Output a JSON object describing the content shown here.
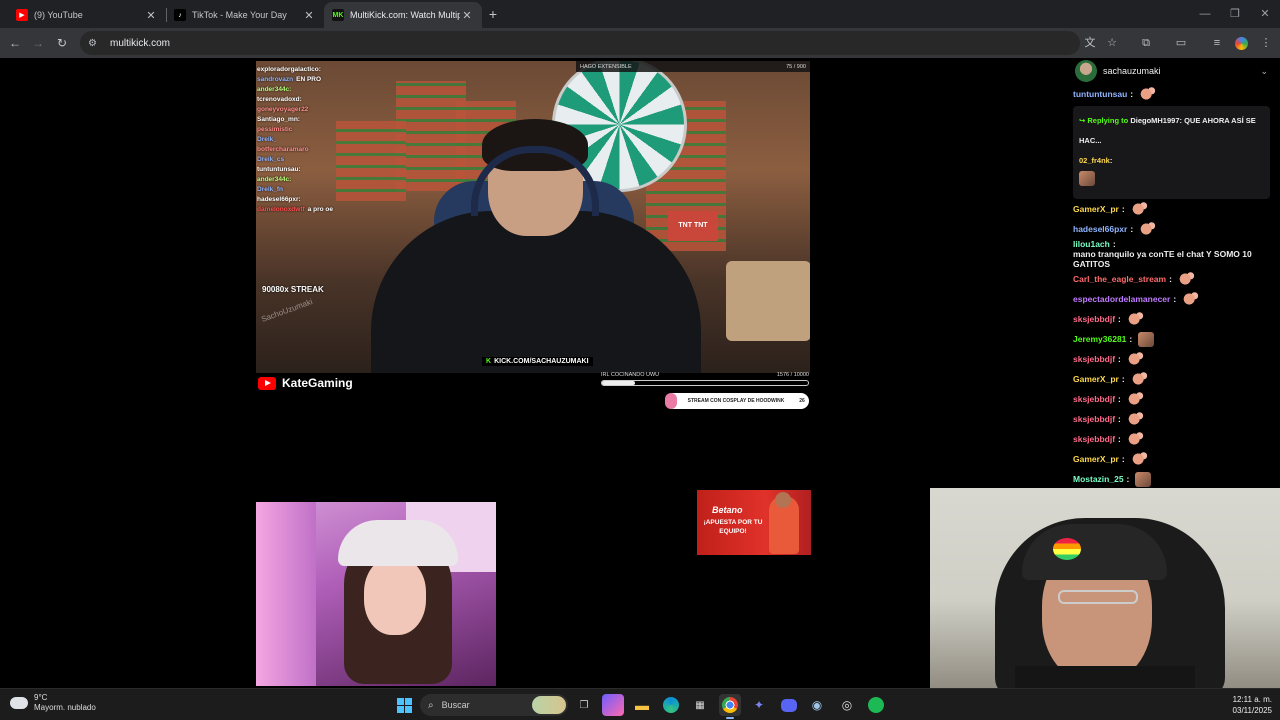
{
  "browser": {
    "tabs": [
      {
        "title": "(9) YouTube",
        "favicon": "youtube-icon",
        "active": false
      },
      {
        "title": "TikTok - Make Your Day",
        "favicon": "tiktok-icon",
        "active": false
      },
      {
        "title": "MultiKick.com: Watch Multiple",
        "favicon": "multikick-icon",
        "active": true
      }
    ],
    "url": "multikick.com"
  },
  "main_stream": {
    "overlay_chat": [
      {
        "user": "exploradorgalactico:",
        "color": "#ffffff"
      },
      {
        "user": "sandrovazn",
        "text": "EN PRO",
        "color": "#8fb4ff"
      },
      {
        "user": "ander344c:",
        "color": "#b5ff7a"
      },
      {
        "user": "tcrenovadoxd:",
        "color": "#ffffff"
      },
      {
        "user": "goneyvoyager22",
        "color": "#ff8a8a"
      },
      {
        "user": "Santiago_mn:",
        "color": "#ffffff"
      },
      {
        "user": "pessimistic",
        "color": "#ff8a8a"
      },
      {
        "user": "Dreik_",
        "color": "#8fb4ff"
      },
      {
        "user": "botfercharamaro",
        "color": "#ff8a8a"
      },
      {
        "user": "Dreik_cs",
        "color": "#8fb4ff"
      },
      {
        "user": "tuntuntunsau:",
        "color": "#ffffff"
      },
      {
        "user": "ander344c:",
        "color": "#b5ff7a"
      },
      {
        "user": "Dreik_fn",
        "color": "#8fb4ff"
      },
      {
        "user": "hadesel66pxr:",
        "color": "#ffffff"
      },
      {
        "user": "damelonoxdwtf",
        "text": "a pro oe",
        "color": "#ff4d4d"
      }
    ],
    "streak": "90080x STREAK",
    "kick_tag": "KICK.COM/SACHAUZUMAKI",
    "goal_top_label": "HAGO EXTENSIBLE",
    "goal_top_count": "75 / 900",
    "goal_bottom_label": "IRL COCINANDO UWU",
    "goal_bottom_count": "1576 / 10000",
    "goal_bottom_progress": 0.16,
    "goal_pill_text": "STREAM CON COSPLAY DE HOODWINK",
    "goal_pill_count": "26",
    "watermark": "SachoUzumaki",
    "tnt": "TNT TNT"
  },
  "second_stream": {
    "channel": "KateGaming"
  },
  "ad": {
    "brand": "Betano",
    "tagline": "¡APUESTA POR TU EQUIPO!"
  },
  "chat": {
    "channel": "sachauzumaki",
    "messages": [
      {
        "user": "tuntuntunsau",
        "color": "#8fb4ff",
        "text": "",
        "emote": true
      },
      {
        "reply": true,
        "reply_label": "Replying to",
        "reply_user": "DiegoMH1997",
        "reply_text": "QUE AHORA ASÍ SE HAC...",
        "user": "02_fr4nk",
        "color": "#ffd84d",
        "emote_pic": true
      },
      {
        "user": "GamerX_pr",
        "color": "#ffd84d",
        "text": "",
        "emote": true
      },
      {
        "user": "hadesel66pxr",
        "color": "#8fb4ff",
        "text": "",
        "emote": true
      },
      {
        "user": "lilou1ach",
        "color": "#7affc6",
        "text": "mano tranquilo ya conTE el chat Y SOMO 10 GATITOS"
      },
      {
        "user": "Carl_the_eagle_stream",
        "color": "#ff6b6b",
        "text": "",
        "emote": true
      },
      {
        "user": "espectadordelamanecer",
        "color": "#c07bff",
        "text": "",
        "emote": true
      },
      {
        "user": "sksjebbdjf",
        "color": "#ff6b8a",
        "text": "",
        "emote": true
      },
      {
        "user": "Jeremy36281",
        "color": "#53fc18",
        "text": "",
        "emote_pic": true
      },
      {
        "user": "sksjebbdjf",
        "color": "#ff6b8a",
        "text": "",
        "emote": true
      },
      {
        "user": "GamerX_pr",
        "color": "#ffd84d",
        "text": "",
        "emote": true
      },
      {
        "user": "sksjebbdjf",
        "color": "#ff6b8a",
        "text": "",
        "emote": true
      },
      {
        "user": "sksjebbdjf",
        "color": "#ff6b8a",
        "text": "",
        "emote": true
      },
      {
        "user": "sksjebbdjf",
        "color": "#ff6b8a",
        "text": "",
        "emote": true
      },
      {
        "user": "GamerX_pr",
        "color": "#ffd84d",
        "text": "",
        "emote": true
      },
      {
        "user": "Mostazin_25",
        "color": "#7affc6",
        "text": "",
        "emote_pic": true
      }
    ]
  },
  "taskbar": {
    "weather_temp": "9°C",
    "weather_desc": "Mayorm. nublado",
    "search_placeholder": "Buscar",
    "time": "12:11 a. m.",
    "date": "03/11/2025",
    "apps": [
      "file-explorer-icon",
      "copilot-icon",
      "folder-icon",
      "edge-icon",
      "store-icon",
      "chrome-icon",
      "teams-icon",
      "discord-icon",
      "steam-icon",
      "ea-icon",
      "spotify-icon"
    ]
  },
  "colors": {
    "kick_green": "#53fc18",
    "youtube_red": "#ff0000",
    "chrome_dark": "#202124"
  }
}
